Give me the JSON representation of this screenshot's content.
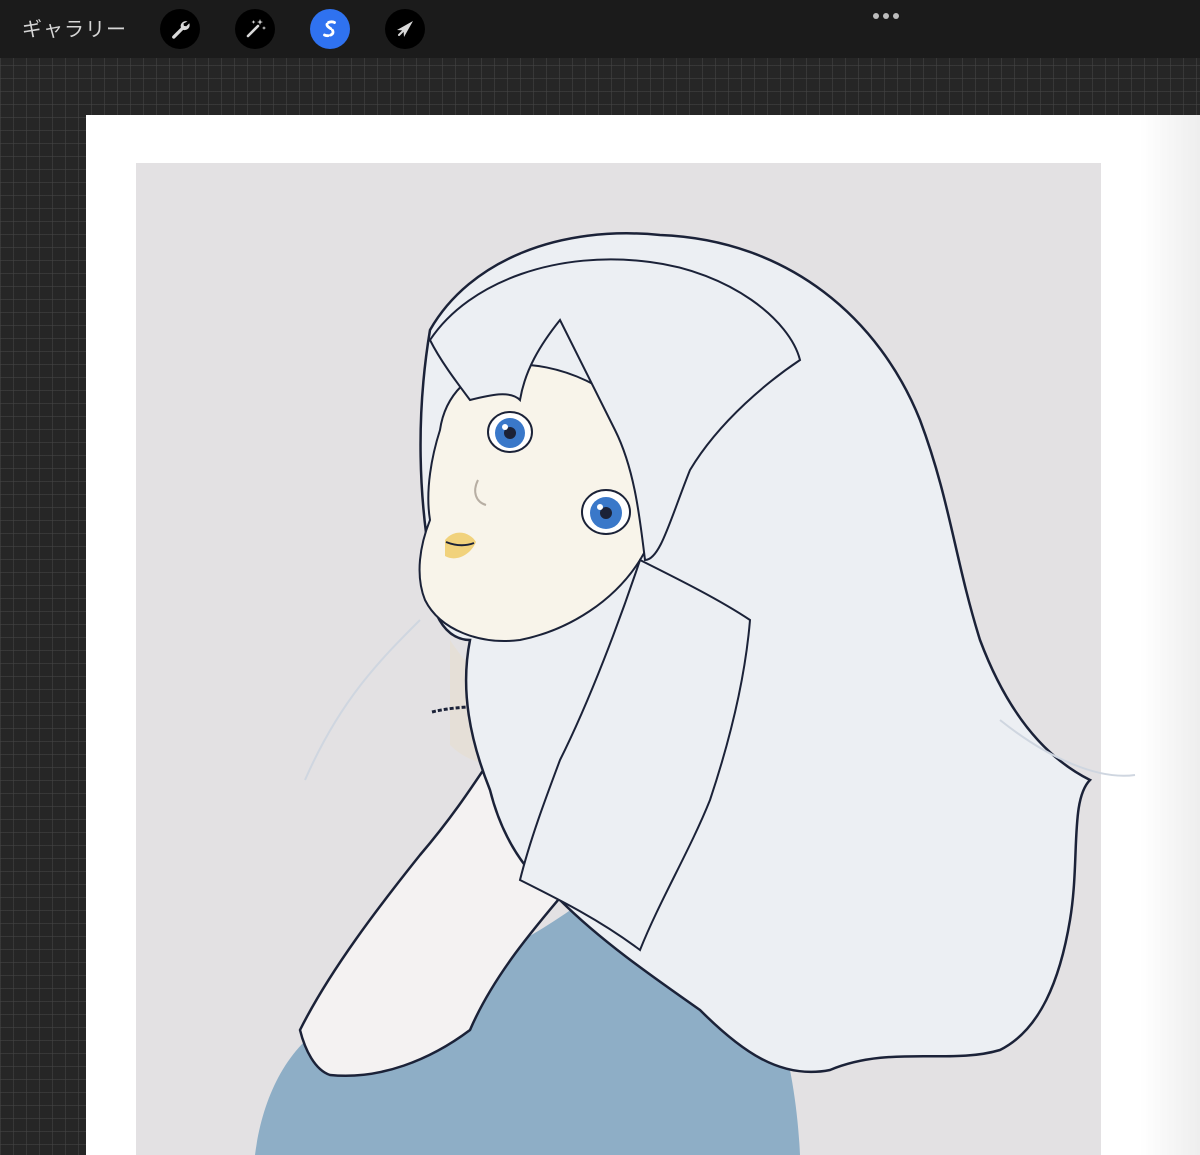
{
  "toolbar": {
    "gallery_label": "ギャラリー",
    "tools": [
      {
        "name": "actions",
        "icon": "wrench-icon",
        "active": false
      },
      {
        "name": "adjustments",
        "icon": "magic-wand-icon",
        "active": false
      },
      {
        "name": "selection",
        "icon": "selection-s-icon",
        "active": true
      },
      {
        "name": "transform",
        "icon": "arrow-cursor-icon",
        "active": false
      }
    ],
    "more_icon": "more-dots-icon",
    "accent_color": "#2f72f0"
  },
  "canvas": {
    "background_color": "#ffffff",
    "artwork_background_color": "#e3e1e3",
    "artwork_subject": "illustration-girl-white-hair-looking-back",
    "hair_color": "#eceff3",
    "eye_color": "#3a78c9",
    "shirt_color": "#8eaec6",
    "line_color": "#1b2238"
  }
}
